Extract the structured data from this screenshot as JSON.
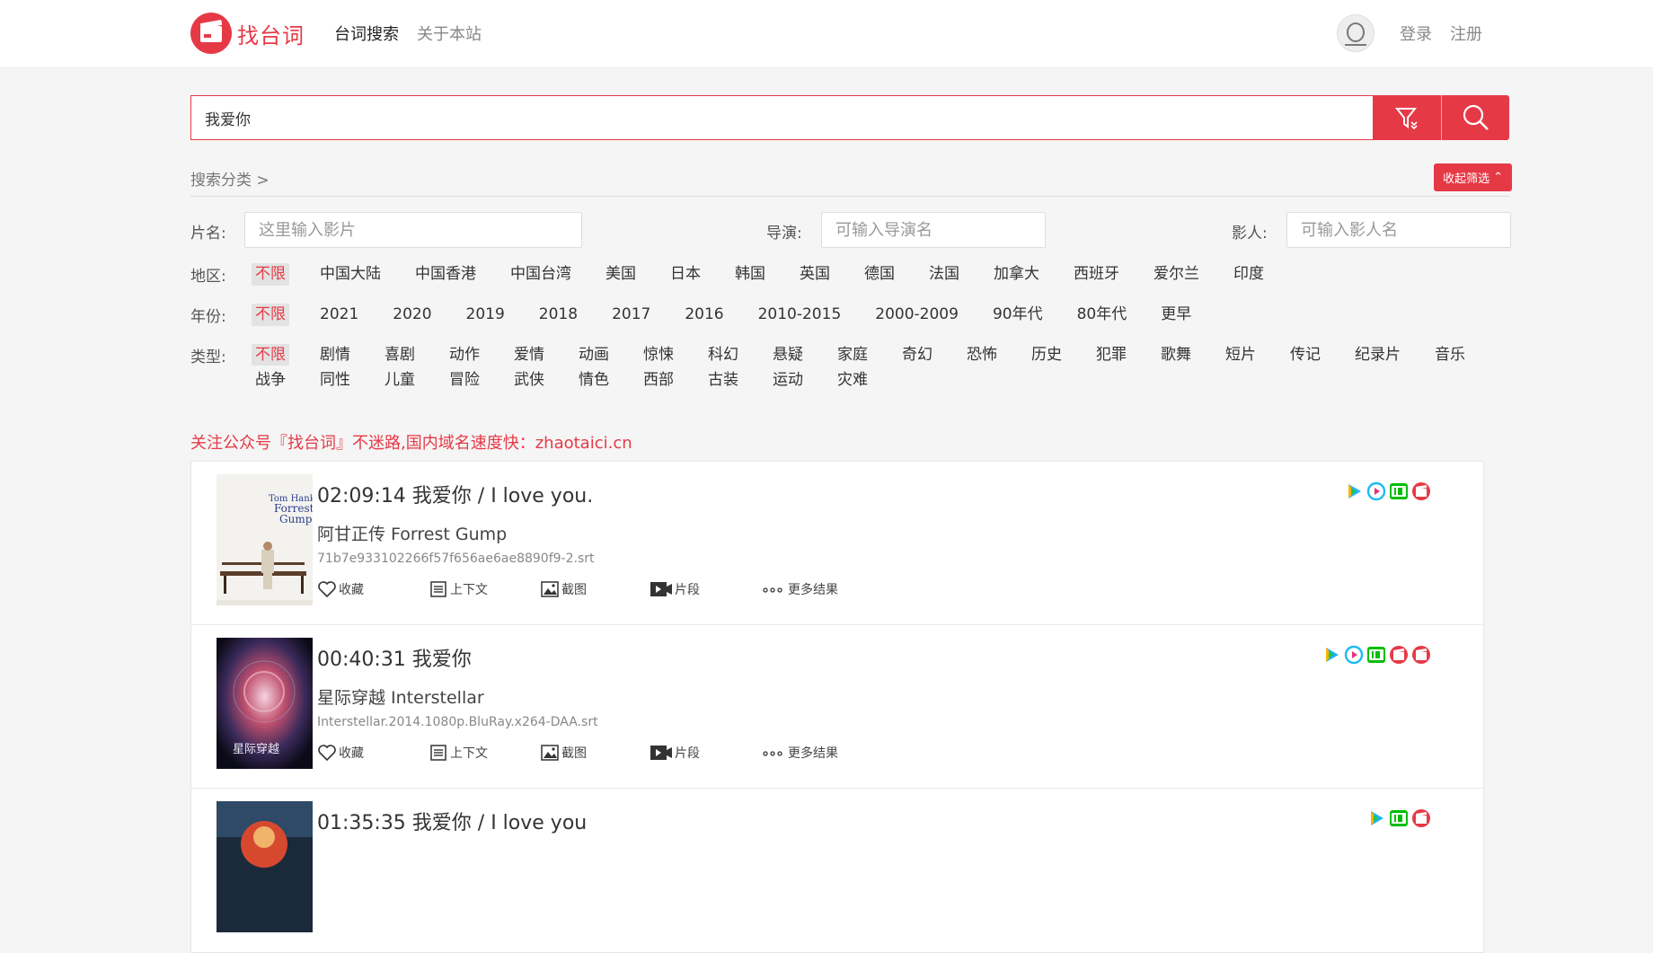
{
  "header": {
    "logo_text": "找台词",
    "nav": [
      {
        "label": "台词搜索"
      },
      {
        "label": "关于本站"
      }
    ],
    "login": "登录",
    "register": "注册"
  },
  "search": {
    "value": "我爱你"
  },
  "filters": {
    "breadcrumb": "搜索分类 >",
    "collapse_label": "收起筛选",
    "title_label": "片名:",
    "title_placeholder": "这里输入影片",
    "director_label": "导演:",
    "director_placeholder": "可输入导演名",
    "actor_label": "影人:",
    "actor_placeholder": "可输入影人名",
    "region_label": "地区:",
    "regions": [
      "不限",
      "中国大陆",
      "中国香港",
      "中国台湾",
      "美国",
      "日本",
      "韩国",
      "英国",
      "德国",
      "法国",
      "加拿大",
      "西班牙",
      "爱尔兰",
      "印度"
    ],
    "year_label": "年份:",
    "years": [
      "不限",
      "2021",
      "2020",
      "2019",
      "2018",
      "2017",
      "2016",
      "2010-2015",
      "2000-2009",
      "90年代",
      "80年代",
      "更早"
    ],
    "genre_label": "类型:",
    "genres": [
      "不限",
      "剧情",
      "喜剧",
      "动作",
      "爱情",
      "动画",
      "惊悚",
      "科幻",
      "悬疑",
      "家庭",
      "奇幻",
      "恐怖",
      "历史",
      "犯罪",
      "歌舞",
      "短片",
      "传记",
      "纪录片",
      "音乐",
      "战争",
      "同性",
      "儿童",
      "冒险",
      "武侠",
      "情色",
      "西部",
      "古装",
      "运动",
      "灾难"
    ]
  },
  "notice": "关注公众号『找台词』不迷路,国内域名速度快：zhaotaici.cn",
  "actions": {
    "favorite": "收藏",
    "context": "上下文",
    "screenshot": "截图",
    "clip": "片段",
    "more": "更多结果"
  },
  "results": [
    {
      "time_title": "02:09:14 我爱你 / I love you.",
      "movie": "阿甘正传 Forrest Gump",
      "file": "71b7e933102266f57f656ae6ae8890f9-2.srt",
      "poster_text": [
        "Tom Hanks",
        "Forrest",
        "Gump"
      ],
      "platforms": [
        "tencent",
        "youku",
        "iqiyi",
        "film"
      ]
    },
    {
      "time_title": "00:40:31 我爱你",
      "movie": "星际穿越 Interstellar",
      "file": "Interstellar.2014.1080p.BluRay.x264-DAA.srt",
      "poster_text": [
        "星际穿越"
      ],
      "platforms": [
        "tencent",
        "youku",
        "iqiyi",
        "film",
        "film"
      ]
    },
    {
      "time_title": "01:35:35 我爱你 / I love you",
      "movie": "",
      "file": "",
      "poster_text": [],
      "platforms": [
        "tencent",
        "iqiyi",
        "film"
      ]
    }
  ]
}
